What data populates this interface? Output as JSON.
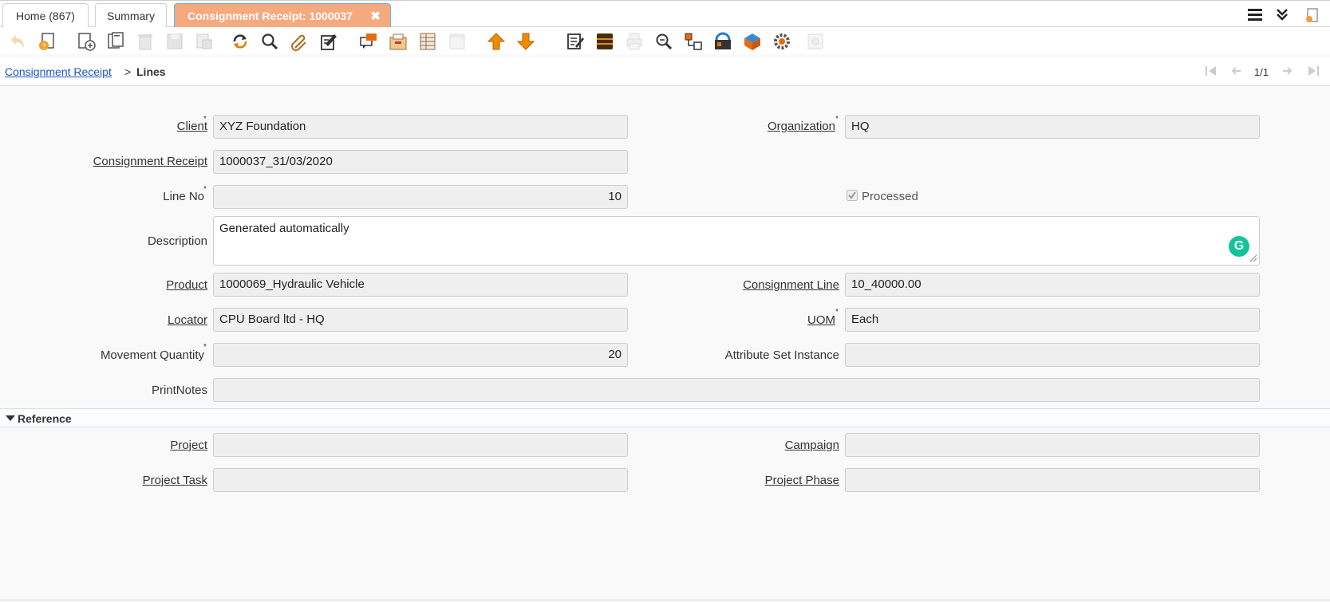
{
  "tabs": [
    {
      "label": "Home (867)"
    },
    {
      "label": "Summary"
    },
    {
      "label": "Consignment Receipt: 1000037",
      "close": "✖"
    }
  ],
  "breadcrumb": {
    "parent": "Consignment Receipt",
    "separator": ">",
    "current": "Lines"
  },
  "pager": {
    "text": "1/1"
  },
  "form": {
    "client": {
      "label": "Client",
      "value": "XYZ Foundation",
      "required": "*"
    },
    "organization": {
      "label": "Organization",
      "value": "HQ",
      "required": "*"
    },
    "consignment_receipt": {
      "label": "Consignment Receipt",
      "value": "1000037_31/03/2020"
    },
    "line_no": {
      "label": "Line No",
      "value": "10",
      "required": "*"
    },
    "processed": {
      "label": "Processed",
      "checked": true
    },
    "description": {
      "label": "Description",
      "value": "Generated automatically"
    },
    "product": {
      "label": "Product",
      "value": "1000069_Hydraulic Vehicle"
    },
    "consignment_line": {
      "label": "Consignment Line",
      "value": "10_40000.00"
    },
    "locator": {
      "label": "Locator",
      "value": "CPU Board ltd - HQ"
    },
    "uom": {
      "label": "UOM",
      "value": "Each",
      "required": "*"
    },
    "movement_quantity": {
      "label": "Movement Quantity",
      "value": "20",
      "required": "*"
    },
    "attribute_set_instance": {
      "label": "Attribute Set Instance",
      "value": ""
    },
    "print_notes": {
      "label": "PrintNotes",
      "value": ""
    }
  },
  "reference": {
    "title": "Reference",
    "project": {
      "label": "Project",
      "value": ""
    },
    "campaign": {
      "label": "Campaign",
      "value": ""
    },
    "project_task": {
      "label": "Project Task",
      "value": ""
    },
    "project_phase": {
      "label": "Project Phase",
      "value": ""
    }
  },
  "colors": {
    "active_tab": "#f5a97f",
    "link": "#1a55c6",
    "arrow": "#f08a00",
    "grammarly": "#15c39a"
  }
}
